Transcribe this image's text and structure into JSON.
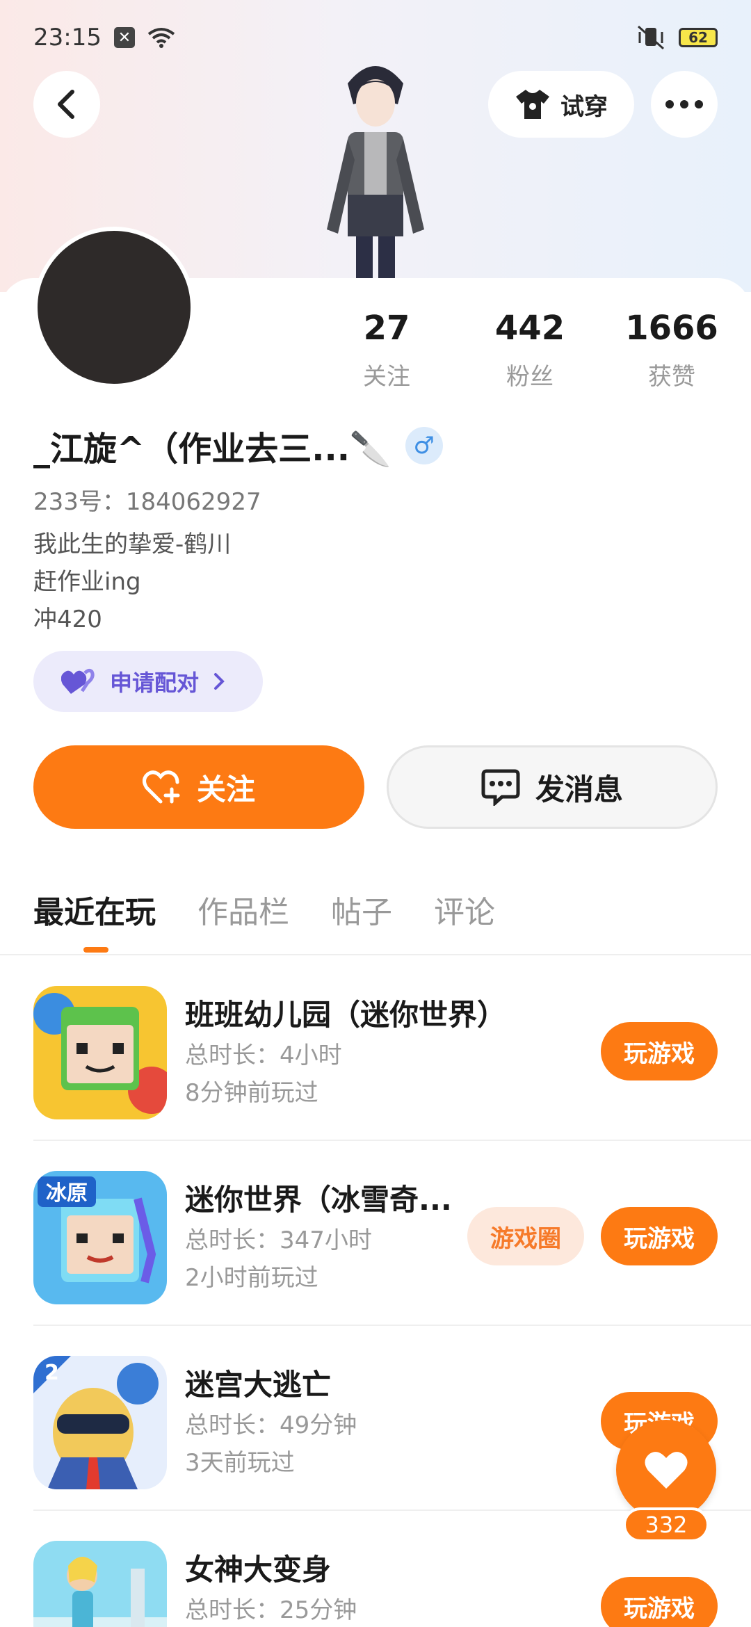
{
  "status_bar": {
    "time": "23:15",
    "battery": "62",
    "icons": [
      "notification-box-icon",
      "wifi-icon",
      "mute-icon",
      "battery-icon"
    ]
  },
  "header": {
    "back_icon": "chevron-left-icon",
    "try_on_label": "试穿",
    "more_icon": "more-dots-icon"
  },
  "profile": {
    "stats": [
      {
        "value": "27",
        "label": "关注"
      },
      {
        "value": "442",
        "label": "粉丝"
      },
      {
        "value": "1666",
        "label": "获赞"
      }
    ],
    "nickname": "_江旋^（作业去三...🔪",
    "gender_symbol": "♂",
    "uid": "233号：184062927",
    "bio_lines": [
      "我此生的挚爱-鹤川",
      "赶作业ing",
      "冲420"
    ],
    "pair_label": "申请配对",
    "follow_label": "关注",
    "message_label": "发消息"
  },
  "tabs": [
    {
      "label": "最近在玩",
      "active": true
    },
    {
      "label": "作品栏",
      "active": false
    },
    {
      "label": "帖子",
      "active": false
    },
    {
      "label": "评论",
      "active": false
    }
  ],
  "games": [
    {
      "name": "班班幼儿园（迷你世界）",
      "duration": "总时长：4小时",
      "last_played": "8分钟前玩过",
      "play_label": "玩游戏",
      "circle_label": ""
    },
    {
      "name": "迷你世界（冰雪奇...",
      "duration": "总时长：347小时",
      "last_played": "2小时前玩过",
      "play_label": "玩游戏",
      "circle_label": "游戏圈",
      "badge": "冰原"
    },
    {
      "name": "迷宫大逃亡",
      "duration": "总时长：49分钟",
      "last_played": "3天前玩过",
      "play_label": "玩游戏",
      "circle_label": "",
      "badge": "2"
    },
    {
      "name": "女神大变身",
      "duration": "总时长：25分钟",
      "last_played": "",
      "play_label": "玩游戏",
      "circle_label": ""
    }
  ],
  "like_fab": {
    "count": "332"
  },
  "colors": {
    "accent": "#fd7a13",
    "pair_bg": "#ecebfb",
    "pair_text": "#6656d6",
    "gender_blue": "#3e8fe4"
  }
}
